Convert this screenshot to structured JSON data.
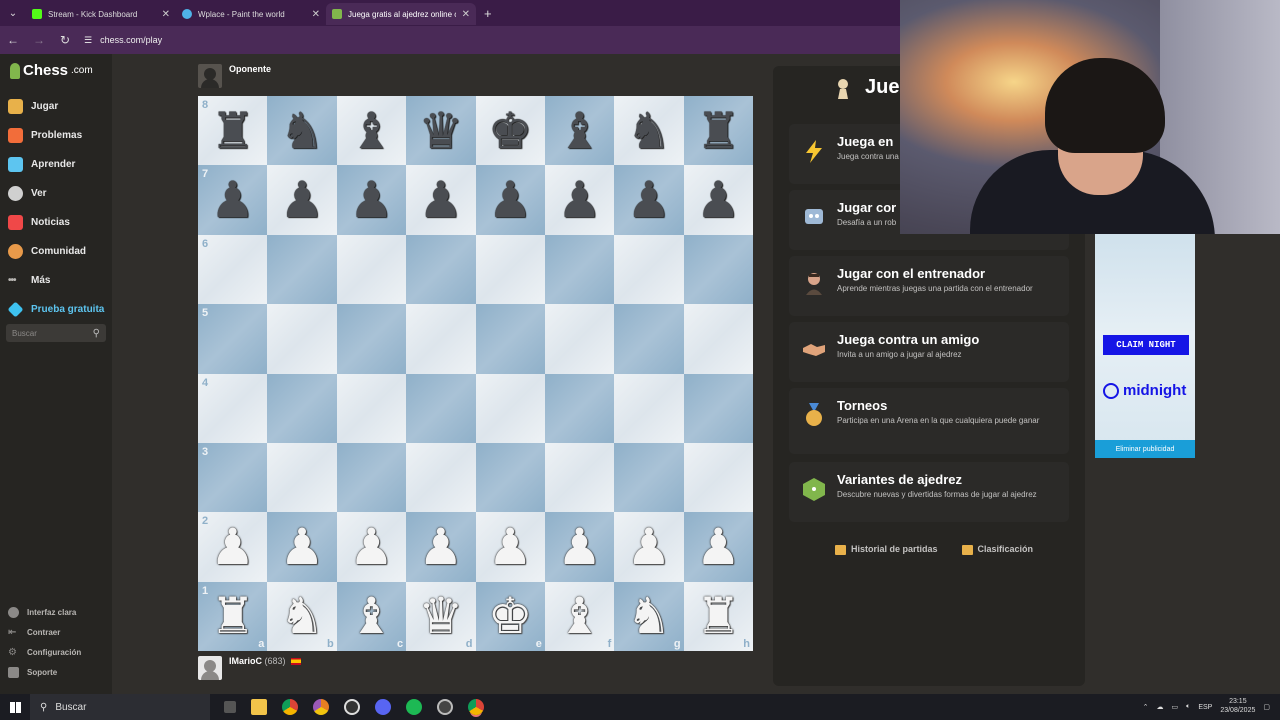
{
  "browser": {
    "tabs": [
      {
        "title": "Stream - Kick Dashboard",
        "color": "#53fc18",
        "active": false
      },
      {
        "title": "Wplace - Paint the world",
        "color": "#4fb3e8",
        "active": false
      },
      {
        "title": "Juega gratis al ajedrez online c",
        "color": "#81b64c",
        "active": true
      }
    ],
    "url": "chess.com/play"
  },
  "sidebar": {
    "logo": "Chess",
    "logo_suffix": ".com",
    "items": [
      {
        "label": "Jugar",
        "icon": "play-icon",
        "color": "#e8b14a"
      },
      {
        "label": "Problemas",
        "icon": "puzzle-icon",
        "color": "#f26d3a"
      },
      {
        "label": "Aprender",
        "icon": "learn-icon",
        "color": "#5dc5f0"
      },
      {
        "label": "Ver",
        "icon": "watch-icon",
        "color": "#d0d0d0"
      },
      {
        "label": "Noticias",
        "icon": "news-icon",
        "color": "#f04848"
      },
      {
        "label": "Comunidad",
        "icon": "community-icon",
        "color": "#e89a4a"
      },
      {
        "label": "Más",
        "icon": "more-icon",
        "color": "#b8b6b3"
      },
      {
        "label": "Prueba gratuita",
        "icon": "diamond-icon",
        "color": "#3ec2f0"
      }
    ],
    "search_placeholder": "Buscar",
    "bottom": [
      "Interfaz clara",
      "Contraer",
      "Configuración",
      "Soporte"
    ]
  },
  "game": {
    "opponent": {
      "name": "Oponente"
    },
    "player": {
      "name": "IMarioC",
      "rating": "(683)"
    },
    "ranks": [
      "8",
      "7",
      "6",
      "5",
      "4",
      "3",
      "2",
      "1"
    ],
    "files": [
      "a",
      "b",
      "c",
      "d",
      "e",
      "f",
      "g",
      "h"
    ],
    "position": [
      [
        "r",
        "n",
        "b",
        "q",
        "k",
        "b",
        "n",
        "r"
      ],
      [
        "p",
        "p",
        "p",
        "p",
        "p",
        "p",
        "p",
        "p"
      ],
      [
        "",
        "",
        "",
        "",
        "",
        "",
        "",
        ""
      ],
      [
        "",
        "",
        "",
        "",
        "",
        "",
        "",
        ""
      ],
      [
        "",
        "",
        "",
        "",
        "",
        "",
        "",
        ""
      ],
      [
        "",
        "",
        "",
        "",
        "",
        "",
        "",
        ""
      ],
      [
        "P",
        "P",
        "P",
        "P",
        "P",
        "P",
        "P",
        "P"
      ],
      [
        "R",
        "N",
        "B",
        "Q",
        "K",
        "B",
        "N",
        "R"
      ]
    ]
  },
  "panel": {
    "title": "Jueg",
    "options": [
      {
        "name": "Juega en",
        "desc": "Juega contra una",
        "icon": "lightning-icon",
        "color": "#f7c631"
      },
      {
        "name": "Jugar cor",
        "desc": "Desafía a un rob",
        "icon": "robot-icon",
        "color": "#9fb9d6"
      },
      {
        "name": "Jugar con el entrenador",
        "desc": "Aprende mientras juegas una partida con el entrenador",
        "icon": "coach-icon",
        "color": "#b57a4a"
      },
      {
        "name": "Juega contra un amigo",
        "desc": "Invita a un amigo a jugar al ajedrez",
        "icon": "handshake-icon",
        "color": "#e0a37a"
      },
      {
        "name": "Torneos",
        "desc": "Participa en una Arena en la que cualquiera puede ganar",
        "icon": "medal-icon",
        "color": "#e8b14a"
      },
      {
        "name": "Variantes de ajedrez",
        "desc": "Descubre nuevas y divertidas formas de jugar al ajedrez",
        "icon": "dice-icon",
        "color": "#81b64c"
      }
    ],
    "footer": [
      {
        "label": "Historial de partidas",
        "icon": "history-icon"
      },
      {
        "label": "Clasificación",
        "icon": "leaderboard-icon"
      }
    ]
  },
  "ad": {
    "button": "CLAIM NIGHT",
    "brand": "midnight",
    "remove": "Eliminar publicidad"
  },
  "taskbar": {
    "search": "Buscar",
    "lang": "ESP",
    "time": "23:15",
    "date": "23/08/2025"
  }
}
